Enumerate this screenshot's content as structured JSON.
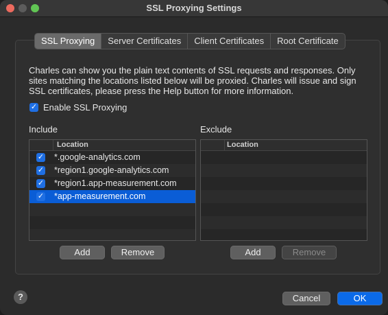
{
  "window": {
    "title": "SSL Proxying Settings"
  },
  "tabs": [
    {
      "label": "SSL Proxying",
      "active": true
    },
    {
      "label": "Server Certificates",
      "active": false
    },
    {
      "label": "Client Certificates",
      "active": false
    },
    {
      "label": "Root Certificate",
      "active": false
    }
  ],
  "description": "Charles can show you the plain text contents of SSL requests and responses. Only sites matching the locations listed below will be proxied. Charles will issue and sign SSL certificates, please press the Help button for more information.",
  "enable_ssl": {
    "label": "Enable SSL Proxying",
    "checked": true,
    "check_glyph": "✓"
  },
  "include": {
    "label": "Include",
    "column_header": "Location",
    "rows": [
      {
        "location": "*.google-analytics.com",
        "checked": true,
        "selected": false
      },
      {
        "location": "*region1.google-analytics.com",
        "checked": true,
        "selected": false
      },
      {
        "location": "*region1.app-measurement.com",
        "checked": true,
        "selected": false
      },
      {
        "location": "*app-measurement.com",
        "checked": true,
        "selected": true
      }
    ],
    "add_label": "Add",
    "remove_label": "Remove"
  },
  "exclude": {
    "label": "Exclude",
    "column_header": "Location",
    "rows": [],
    "add_label": "Add",
    "remove_label": "Remove"
  },
  "footer": {
    "help_label": "?",
    "cancel_label": "Cancel",
    "ok_label": "OK"
  },
  "colors": {
    "accent": "#0a5dd6",
    "checkbox": "#1f6fe3"
  }
}
